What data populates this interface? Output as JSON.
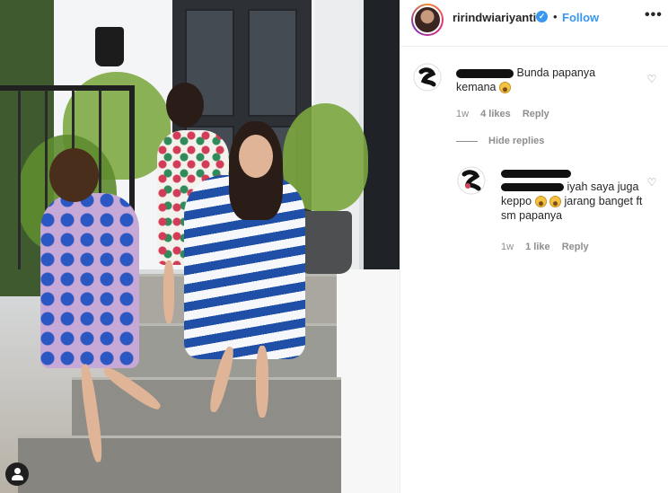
{
  "photo": {
    "alt_icon": "user-tag-icon"
  },
  "post_header": {
    "username": "ririndwiariyanti",
    "verified_icon": "verified-badge-icon",
    "separator": "•",
    "follow_label": "Follow",
    "more_label": "•••"
  },
  "comments": [
    {
      "text": "Bunda papanya kemana",
      "emoji_icon": "sad-face-emoji",
      "time": "1w",
      "likes": "4 likes",
      "reply_label": "Reply"
    }
  ],
  "hide_replies_label": "Hide replies",
  "replies": [
    {
      "text_part1": "iyah saya juga keppo",
      "emoji_icons": [
        "sad-face-emoji",
        "sad-face-emoji"
      ],
      "text_part2": "jarang banget ft sm papanya",
      "time": "1w",
      "likes": "1 like",
      "reply_label": "Reply"
    }
  ],
  "colors": {
    "accent": "#3897f0",
    "muted": "#8e8e8e",
    "text": "#262626"
  }
}
